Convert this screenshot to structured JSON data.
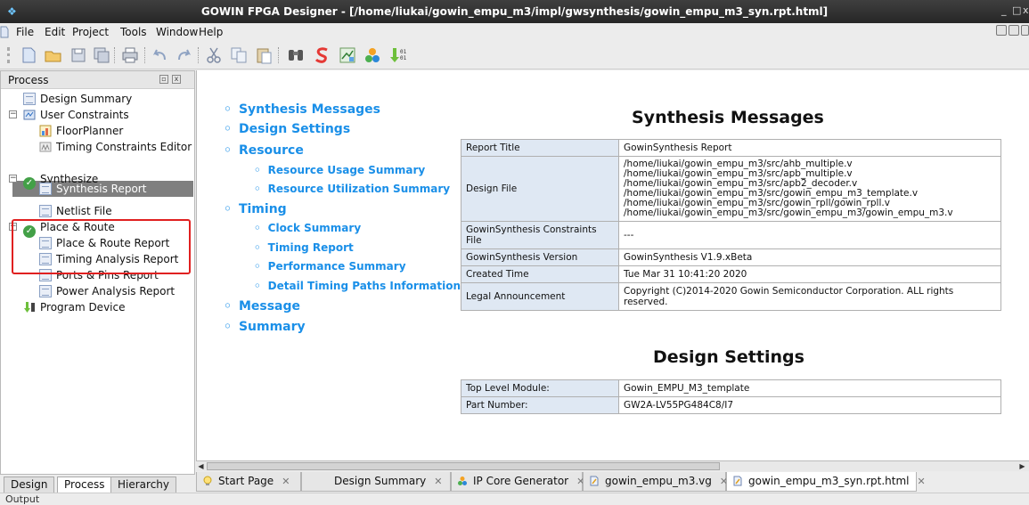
{
  "window": {
    "title": "GOWIN FPGA Designer - [/home/liukai/gowin_empu_m3/impl/gwsynthesis/gowin_empu_m3_syn.rpt.html]",
    "controls": [
      "_",
      "□",
      "x"
    ]
  },
  "menu": {
    "items": [
      "File",
      "Edit",
      "Project",
      "Tools",
      "Window",
      "Help"
    ],
    "mnemonics": [
      "F",
      "E",
      "P",
      "T",
      "W",
      "H"
    ]
  },
  "toolbar": {
    "icons": [
      "new-file-icon",
      "open-folder-icon",
      "save-icon",
      "save-all-icon",
      "print-icon",
      "undo-icon",
      "redo-icon",
      "cut-icon",
      "copy-icon",
      "paste-icon",
      "find-icon",
      "synthesize-icon",
      "place-route-icon",
      "ip-core-icon",
      "program-device-icon"
    ]
  },
  "process_panel": {
    "title": "Process",
    "tree": [
      {
        "label": "Design Summary",
        "icon": "document-icon"
      },
      {
        "label": "User Constraints",
        "icon": "constraints-icon"
      },
      {
        "label": "FloorPlanner",
        "icon": "floorplanner-icon"
      },
      {
        "label": "Timing Constraints Editor",
        "icon": "timing-editor-icon"
      },
      {
        "label": "Synthesize",
        "icon": "check-icon"
      },
      {
        "label": "Synthesis Report",
        "icon": "document-icon"
      },
      {
        "label": "Netlist File",
        "icon": "document-icon"
      },
      {
        "label": "Place & Route",
        "icon": "check-icon"
      },
      {
        "label": "Place & Route Report",
        "icon": "document-icon"
      },
      {
        "label": "Timing Analysis Report",
        "icon": "document-icon"
      },
      {
        "label": "Ports & Pins Report",
        "icon": "document-icon"
      },
      {
        "label": "Power Analysis Report",
        "icon": "document-icon"
      },
      {
        "label": "Program Device",
        "icon": "program-device-icon"
      }
    ],
    "selected": "Synthesis Report"
  },
  "left_tabs": [
    "Design",
    "Process",
    "Hierarchy"
  ],
  "left_tab_active": "Process",
  "toc": [
    {
      "label": "Synthesis Messages",
      "level": 1
    },
    {
      "label": "Design Settings",
      "level": 1
    },
    {
      "label": "Resource",
      "level": 1
    },
    {
      "label": "Resource Usage Summary",
      "level": 2
    },
    {
      "label": "Resource Utilization Summary",
      "level": 2
    },
    {
      "label": "Timing",
      "level": 1
    },
    {
      "label": "Clock Summary",
      "level": 2
    },
    {
      "label": "Timing Report",
      "level": 2
    },
    {
      "label": "Performance Summary",
      "level": 2
    },
    {
      "label": "Detail Timing Paths Informations",
      "level": 2
    },
    {
      "label": "Message",
      "level": 1
    },
    {
      "label": "Summary",
      "level": 1
    }
  ],
  "synthesis_messages": {
    "heading": "Synthesis Messages",
    "rows": [
      {
        "key": "Report Title",
        "value": "GowinSynthesis Report"
      },
      {
        "key": "Design File",
        "lines": [
          "/home/liukai/gowin_empu_m3/src/ahb_multiple.v",
          "/home/liukai/gowin_empu_m3/src/apb_multiple.v",
          "/home/liukai/gowin_empu_m3/src/apb2_decoder.v",
          "/home/liukai/gowin_empu_m3/src/gowin_empu_m3_template.v",
          "/home/liukai/gowin_empu_m3/src/gowin_rpll/gowin_rpll.v",
          "/home/liukai/gowin_empu_m3/src/gowin_empu_m3/gowin_empu_m3.v"
        ]
      },
      {
        "key": "GowinSynthesis Constraints File",
        "value": "---"
      },
      {
        "key": "GowinSynthesis Version",
        "value": "GowinSynthesis V1.9.xBeta"
      },
      {
        "key": "Created Time",
        "value": "Tue Mar 31 10:41:20 2020"
      },
      {
        "key": "Legal Announcement",
        "value": "Copyright (C)2014-2020 Gowin Semiconductor Corporation. ALL rights reserved."
      }
    ]
  },
  "design_settings": {
    "heading": "Design Settings",
    "rows": [
      {
        "key": "Top Level Module:",
        "value": "Gowin_EMPU_M3_template"
      },
      {
        "key": "Part Number:",
        "value": "GW2A-LV55PG484C8/I7"
      }
    ]
  },
  "doc_tabs": [
    {
      "label": "Start Page",
      "icon": "bulb-icon"
    },
    {
      "label": "Design Summary",
      "icon": ""
    },
    {
      "label": "IP Core Generator",
      "icon": "ip-core-icon"
    },
    {
      "label": "gowin_empu_m3.vg",
      "icon": "file-icon"
    },
    {
      "label": "gowin_empu_m3_syn.rpt.html",
      "icon": "file-icon"
    }
  ],
  "doc_tab_active": "gowin_empu_m3_syn.rpt.html",
  "close_glyph": "✕",
  "status": {
    "label": "Output"
  }
}
